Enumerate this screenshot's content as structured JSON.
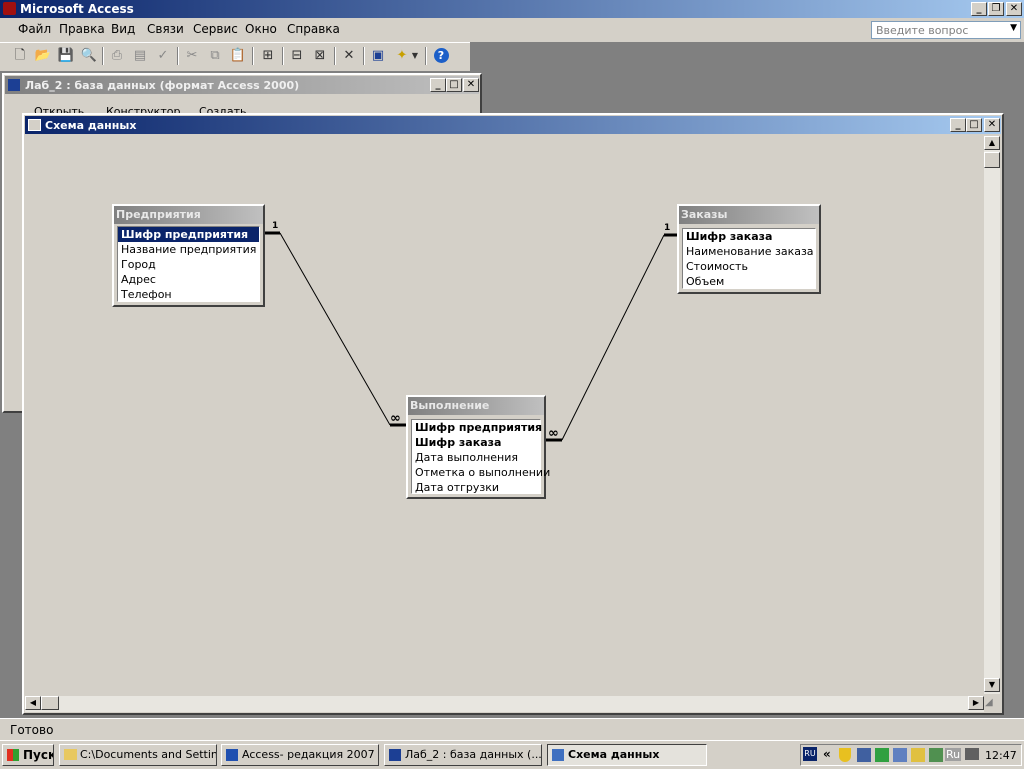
{
  "app": {
    "title": "Microsoft Access",
    "help_placeholder": "Введите вопрос"
  },
  "menu": [
    "Файл",
    "Правка",
    "Вид",
    "Связи",
    "Сервис",
    "Окно",
    "Справка"
  ],
  "db_window": {
    "title": "Лаб_2 : база данных (формат Access 2000)",
    "toolbar": [
      "Открыть",
      "Конструктор",
      "Создать"
    ]
  },
  "schema_window": {
    "title": "Схема данных"
  },
  "tables": {
    "enterprises": {
      "title": "Предприятия",
      "fields": [
        "Шифр предприятия",
        "Название предприятия",
        "Город",
        "Адрес",
        "Телефон"
      ]
    },
    "orders": {
      "title": "Заказы",
      "fields": [
        "Шифр заказа",
        "Наименование заказа",
        "Стоимость",
        "Объем"
      ]
    },
    "execution": {
      "title": "Выполнение",
      "fields": [
        "Шифр предприятия",
        "Шифр заказа",
        "Дата выполнения",
        "Отметка о выполнении",
        "Дата отгрузки"
      ]
    }
  },
  "relations": {
    "one": "1",
    "many": "∞"
  },
  "status": "Готово",
  "taskbar": {
    "start": "Пуск",
    "tasks": [
      "C:\\Documents and Settin...",
      "Access- редакция 2007 ...",
      "Лаб_2 : база данных (...",
      "Схема данных"
    ],
    "lang": "Ru",
    "clock": "12:47"
  }
}
